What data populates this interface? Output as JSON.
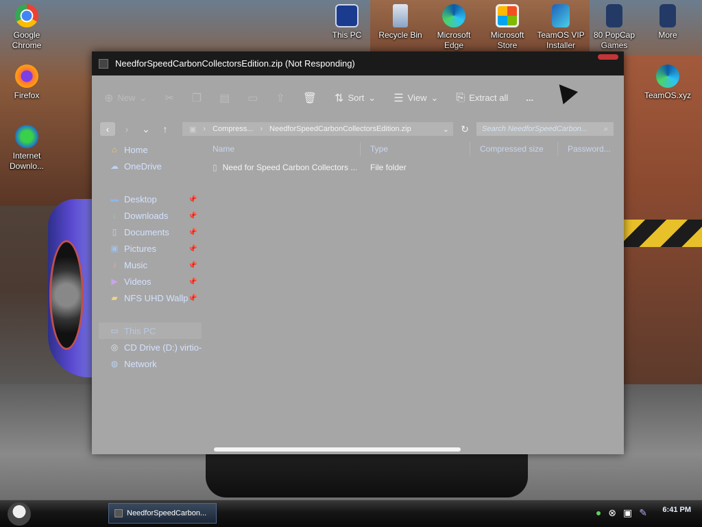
{
  "desktop": {
    "left_icons": [
      {
        "label": "Google Chrome",
        "icon": "chrome-icon"
      },
      {
        "label": "Firefox",
        "icon": "firefox-icon"
      },
      {
        "label": "Internet Downlo...",
        "icon": "idm-icon"
      }
    ],
    "top_icons": [
      {
        "label": "This PC",
        "icon": "computer-icon"
      },
      {
        "label": "Recycle Bin",
        "icon": "recycle-bin-icon"
      },
      {
        "label": "Microsoft Edge",
        "icon": "edge-icon"
      },
      {
        "label": "Microsoft Store",
        "icon": "store-icon"
      },
      {
        "label": "TeamOS VIP Installer",
        "icon": "installer-icon"
      },
      {
        "label": "80 PopCap Games",
        "icon": "popcap-icon"
      },
      {
        "label": "More",
        "icon": "more-icon"
      }
    ],
    "right_icons": [
      {
        "label": "TeamOS.xyz",
        "icon": "edge-link-icon"
      }
    ]
  },
  "window": {
    "title": "NeedforSpeedCarbonCollectorsEdition.zip (Not Responding)",
    "toolbar": {
      "new": "New",
      "sort": "Sort",
      "view": "View",
      "extract_all": "Extract all",
      "more": "..."
    },
    "address": {
      "crumb1": "Compress...",
      "crumb2": "NeedforSpeedCarbonCollectorsEdition.zip",
      "search_placeholder": "Search NeedforSpeedCarbon..."
    },
    "nav": {
      "home": "Home",
      "onedrive": "OneDrive",
      "desktop": "Desktop",
      "downloads": "Downloads",
      "documents": "Documents",
      "pictures": "Pictures",
      "music": "Music",
      "videos": "Videos",
      "nfs": "NFS UHD Wallp",
      "thispc": "This PC",
      "cddrive": "CD Drive (D:) virtio-",
      "network": "Network"
    },
    "columns": {
      "name": "Name",
      "type": "Type",
      "compressed": "Compressed size",
      "password": "Password..."
    },
    "rows": [
      {
        "name": "Need for Speed Carbon Collectors ...",
        "type": "File folder"
      }
    ]
  },
  "taskbar": {
    "task_label": "NeedforSpeedCarbon...",
    "clock": "6:41 PM"
  },
  "colors": {
    "window_body": "#a6a6a6",
    "titlebar": "#1a1a1a",
    "link_text": "#d4e2ff"
  }
}
